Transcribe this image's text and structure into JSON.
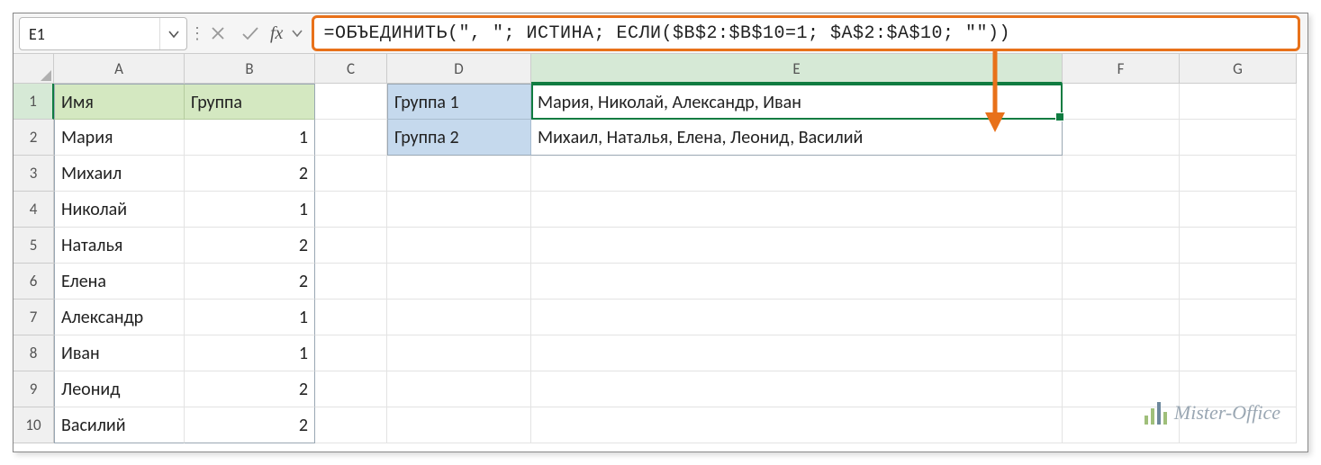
{
  "name_box": {
    "value": "E1"
  },
  "formula_bar": {
    "fx_label": "fx",
    "formula": "=ОБЪЕДИНИТЬ(\", \"; ИСТИНА; ЕСЛИ($B$2:$B$10=1; $A$2:$A$10; \"\"))"
  },
  "columns": [
    "A",
    "B",
    "C",
    "D",
    "E",
    "F",
    "G"
  ],
  "rows": [
    "1",
    "2",
    "3",
    "4",
    "5",
    "6",
    "7",
    "8",
    "9",
    "10"
  ],
  "headers": {
    "A": "Имя",
    "B": "Группа"
  },
  "table_ab": [
    {
      "name": "Мария",
      "group": "1"
    },
    {
      "name": "Михаил",
      "group": "2"
    },
    {
      "name": "Николай",
      "group": "1"
    },
    {
      "name": "Наталья",
      "group": "2"
    },
    {
      "name": "Елена",
      "group": "2"
    },
    {
      "name": "Александр",
      "group": "1"
    },
    {
      "name": "Иван",
      "group": "1"
    },
    {
      "name": "Леонид",
      "group": "2"
    },
    {
      "name": "Василий",
      "group": "2"
    }
  ],
  "groups": [
    {
      "label": "Группа 1",
      "result": "Мария, Николай, Александр, Иван"
    },
    {
      "label": "Группа 2",
      "result": "Михаил, Наталья, Елена, Леонид, Василий"
    }
  ],
  "watermark": "Mister-Office",
  "colors": {
    "accent_orange": "#e8711a",
    "excel_green": "#107c41",
    "header_green": "#d4e8c1",
    "header_blue": "#c5d9ed"
  }
}
